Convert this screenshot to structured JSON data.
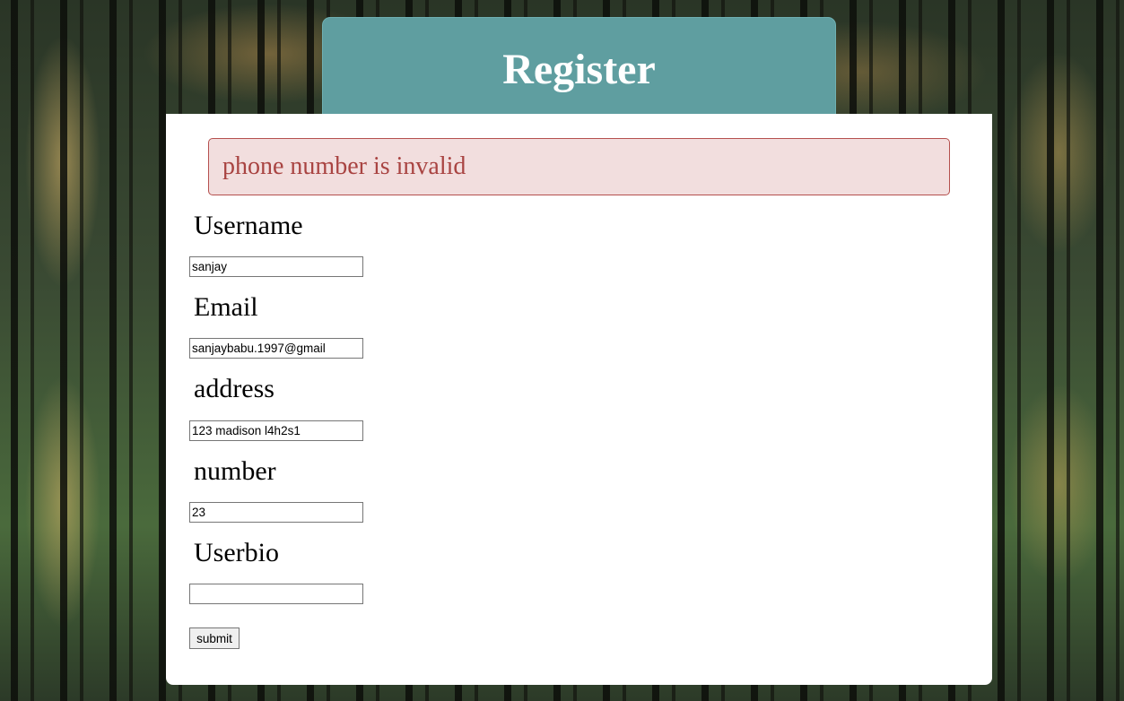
{
  "header": {
    "title": "Register"
  },
  "alert": {
    "message": "phone number is invalid"
  },
  "form": {
    "fields": [
      {
        "label": "Username",
        "value": "sanjay"
      },
      {
        "label": "Email",
        "value": "sanjaybabu.1997@gmail"
      },
      {
        "label": "address",
        "value": "123 madison l4h2s1"
      },
      {
        "label": "number",
        "value": "23"
      },
      {
        "label": "Userbio",
        "value": ""
      }
    ],
    "submit_label": "submit"
  },
  "colors": {
    "header_bg": "#5f9ea0",
    "alert_bg": "#f2dede",
    "alert_text": "#a94442",
    "alert_border": "#b5504e",
    "card_bg": "#ffffff"
  }
}
